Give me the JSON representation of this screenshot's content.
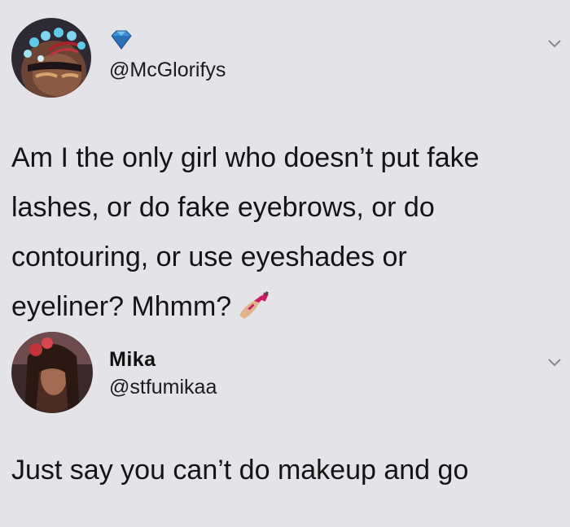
{
  "tweets": [
    {
      "display_name": "",
      "handle": "@McGlorifys",
      "verified_icon": "diamond-icon",
      "lines": [
        "Am I the only girl who doesn’t put fake",
        "lashes, or do fake eyebrows, or do",
        "contouring, or use eyeshades or",
        "eyeliner? Mhmm?"
      ],
      "trailing_emoji": "nail-polish-emoji"
    },
    {
      "display_name": "Mika",
      "handle": "@stfumikaa",
      "lines": [
        "Just say you can’t do makeup and go"
      ]
    }
  ],
  "colors": {
    "background": "#e3e3e8",
    "text": "#141414",
    "diamond": "#3a8fd6",
    "chevron": "#8a8a92"
  }
}
